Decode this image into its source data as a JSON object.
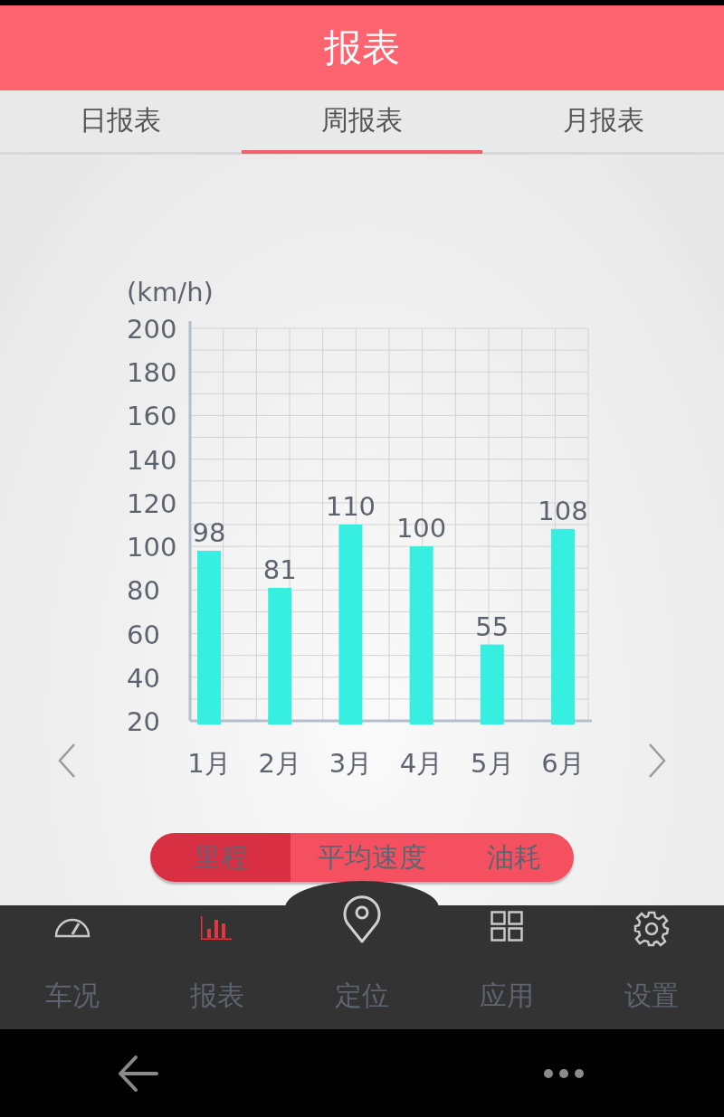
{
  "header": {
    "title": "报表"
  },
  "tabs": [
    {
      "label": "日报表",
      "selected": false
    },
    {
      "label": "周报表",
      "selected": true
    },
    {
      "label": "月报表",
      "selected": false
    }
  ],
  "chart": {
    "chart_data": {
      "type": "bar",
      "ylabel": "(km/h)",
      "categories": [
        "1月",
        "2月",
        "3月",
        "4月",
        "5月",
        "6月"
      ],
      "series": [
        {
          "color": "#36efe0",
          "values": [
            98,
            81,
            110,
            100,
            55,
            108
          ]
        }
      ],
      "ylim": [
        20,
        200
      ],
      "yticks": [
        20,
        40,
        60,
        80,
        100,
        120,
        140,
        160,
        180,
        200
      ],
      "data_labels": true,
      "grid": true
    }
  },
  "segments": [
    {
      "label": "里程",
      "selected": true
    },
    {
      "label": "平均速度",
      "selected": false
    },
    {
      "label": "油耗",
      "selected": false
    }
  ],
  "nav": [
    {
      "label": "车况",
      "kind": "gauge",
      "selected": false
    },
    {
      "label": "报表",
      "kind": "bars",
      "selected": true
    },
    {
      "label": "定位",
      "kind": "pin",
      "selected": false
    },
    {
      "label": "应用",
      "kind": "grid",
      "selected": false
    },
    {
      "label": "设置",
      "kind": "gear",
      "selected": false
    }
  ]
}
